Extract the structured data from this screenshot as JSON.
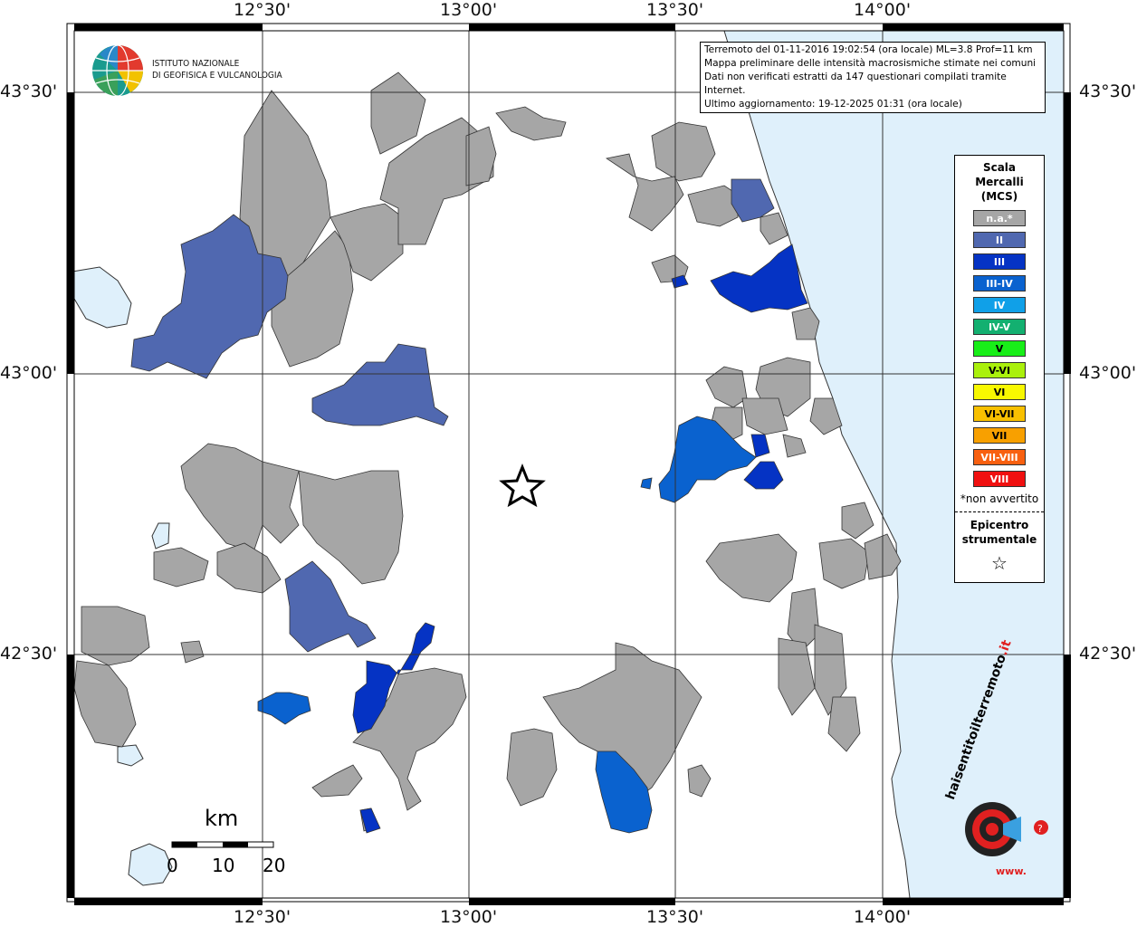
{
  "header": {
    "event_line": "Terremoto del 01-11-2016 19:02:54 (ora locale) ML=3.8 Prof=11 km",
    "line2": "Mappa preliminare delle intensità macrosismiche stimate nei comuni",
    "line3": "Dati non verificati estratti da 147 questionari compilati tramite Internet.",
    "line4": "Ultimo aggiornamento: 19-12-2025 01:31 (ora locale)"
  },
  "institute": {
    "line1": "ISTITUTO NAZIONALE",
    "line2": "DI GEOFISICA E VULCANOLOGIA"
  },
  "axes": {
    "lon_labels": [
      "12°30'",
      "13°00'",
      "13°30'",
      "14°00'"
    ],
    "lat_labels": [
      "43°30'",
      "43°00'",
      "42°30'"
    ]
  },
  "legend": {
    "title_line1": "Scala",
    "title_line2": "Mercalli",
    "title_line3": "(MCS)",
    "items": [
      {
        "label": "n.a.*",
        "color": "#a6a6a6"
      },
      {
        "label": "II",
        "color": "#5068b0"
      },
      {
        "label": "III",
        "color": "#0533c4"
      },
      {
        "label": "III-IV",
        "color": "#0a62cf"
      },
      {
        "label": "IV",
        "color": "#10a0e8"
      },
      {
        "label": "IV-V",
        "color": "#13b070"
      },
      {
        "label": "V",
        "color": "#18ee18"
      },
      {
        "label": "V-VI",
        "color": "#aaf00c"
      },
      {
        "label": "VI",
        "color": "#f8f800"
      },
      {
        "label": "VI-VII",
        "color": "#f8c000"
      },
      {
        "label": "VII",
        "color": "#f8a000"
      },
      {
        "label": "VII-VIII",
        "color": "#f86010"
      },
      {
        "label": "VIII",
        "color": "#f01010"
      }
    ],
    "note": "*non avvertito",
    "epicenter_line1": "Epicentro",
    "epicenter_line2": "strumentale",
    "epicenter_symbol": "☆"
  },
  "scale_bar": {
    "unit": "km",
    "ticks": [
      "0",
      "10",
      "20"
    ]
  },
  "brand": {
    "text_main": "haisentitoilterremoto",
    "text_domain": ".it",
    "text_www": "www."
  },
  "colors": {
    "sea": "#dff0fb",
    "na": "#a6a6a6",
    "ii": "#5068b0",
    "iii": "#0533c4",
    "iii_iv": "#0a62cf",
    "grid": "#333333"
  }
}
